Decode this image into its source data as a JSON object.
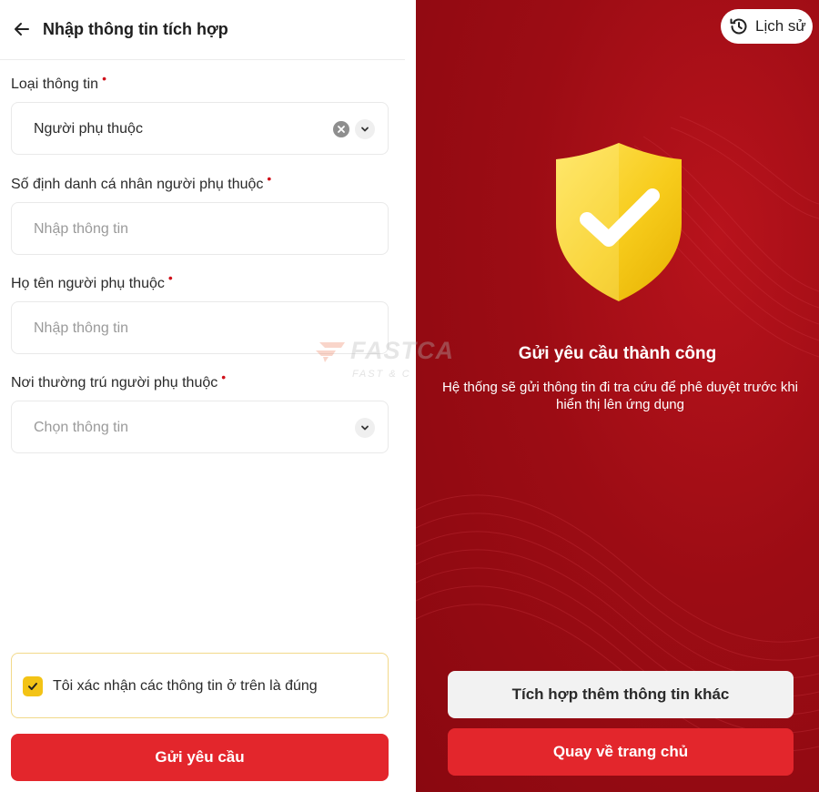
{
  "left_screen": {
    "header": {
      "title": "Nhập thông tin tích hợp"
    },
    "fields": [
      {
        "label": "Loại thông tin",
        "required_mark": "•",
        "value": "Người phụ thuộc",
        "placeholder": ""
      },
      {
        "label": "Số định danh cá nhân người phụ thuộc",
        "required_mark": "•",
        "value": "",
        "placeholder": "Nhập thông tin"
      },
      {
        "label": "Họ tên người phụ thuộc",
        "required_mark": "•",
        "value": "",
        "placeholder": "Nhập thông tin"
      },
      {
        "label": "Nơi thường trú người phụ thuộc",
        "required_mark": "•",
        "value": "",
        "placeholder": "Chọn thông tin"
      }
    ],
    "confirm": {
      "checked": true,
      "text": "Tôi xác nhận các thông tin ở trên là đúng"
    },
    "submit_label": "Gửi yêu cầu"
  },
  "right_screen": {
    "history_label": "Lịch sử",
    "success_title": "Gửi yêu cầu thành công",
    "success_desc_line1": "Hệ thống sẽ gửi thông tin đi tra cứu để phê duyệt trước khi",
    "success_desc_line2": "hiển thị lên ứng dụng",
    "integrate_label": "Tích hợp thêm thông tin khác",
    "home_label": "Quay về trang chủ"
  },
  "watermark": {
    "title": "FASTCA",
    "subtitle": "FAST & C"
  },
  "colors": {
    "primary_red": "#e3262c",
    "background_red": "#9c0c14",
    "checkbox_yellow": "#f3c316",
    "required_red": "#d0111b"
  },
  "icons": [
    "back-arrow-icon",
    "clear-icon",
    "chevron-down-icon",
    "history-icon",
    "check-icon",
    "shield-check-icon"
  ]
}
